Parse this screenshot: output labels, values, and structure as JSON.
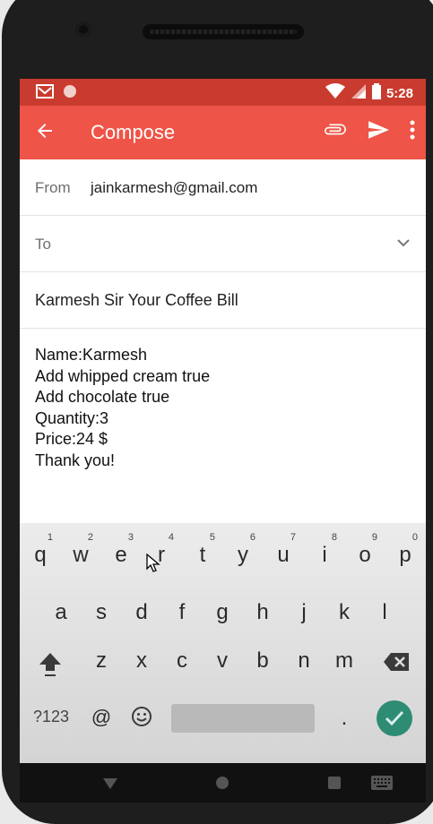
{
  "status_bar": {
    "time": "5:28"
  },
  "app_bar": {
    "title": "Compose"
  },
  "from": {
    "label": "From",
    "value": "jainkarmesh@gmail.com"
  },
  "to": {
    "label": "To"
  },
  "subject": "Karmesh Sir Your Coffee Bill",
  "body_lines": [
    "Name:Karmesh",
    "Add whipped cream true",
    "Add chocolate true",
    "Quantity:3",
    "Price:24 $",
    "Thank you!"
  ],
  "keyboard": {
    "row1": [
      "q",
      "w",
      "e",
      "r",
      "t",
      "y",
      "u",
      "i",
      "o",
      "p"
    ],
    "row1_hints": [
      "1",
      "2",
      "3",
      "4",
      "5",
      "6",
      "7",
      "8",
      "9",
      "0"
    ],
    "row2": [
      "a",
      "s",
      "d",
      "f",
      "g",
      "h",
      "j",
      "k",
      "l"
    ],
    "row3": [
      "z",
      "x",
      "c",
      "v",
      "b",
      "n",
      "m"
    ],
    "symbols_key": "?123",
    "at_key": "@",
    "period_key": "."
  },
  "colors": {
    "status_bar": "#c93b2e",
    "app_bar": "#ee5447",
    "enter_key": "#2e8b74"
  }
}
